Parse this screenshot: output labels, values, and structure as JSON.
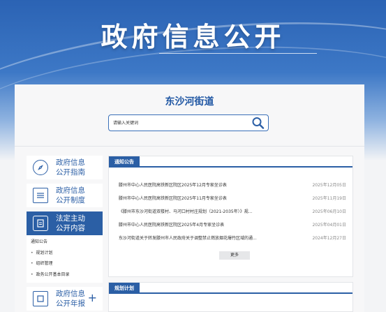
{
  "banner": {
    "title": "政府信息公开"
  },
  "district": {
    "name": "东沙河街道"
  },
  "search": {
    "placeholder": "请输入关键词"
  },
  "sidebar": {
    "items": [
      {
        "line1": "政府信息",
        "line2": "公开指南",
        "icon": "compass-icon"
      },
      {
        "line1": "政府信息",
        "line2": "公开制度",
        "icon": "document-list-icon"
      },
      {
        "line1": "法定主动",
        "line2": "公开内容",
        "icon": "clipboard-icon"
      },
      {
        "line1": "政府信息",
        "line2": "公开年报",
        "icon": "plus-icon"
      }
    ],
    "sub_items": [
      "通知公告",
      "规划计划",
      "组织管理",
      "政务公开基本目录"
    ]
  },
  "notice": {
    "heading": "通知公告",
    "items": [
      {
        "title": "滕州市中心人民医院高铁新区院区2025年12月专家坐诊表",
        "date": "2025年12月05日"
      },
      {
        "title": "滕州市中心人民医院高铁新区院区2025年11月专家坐诊表",
        "date": "2025年11月19日"
      },
      {
        "title": "《滕州市东沙河街道双楼村、马河口村村庄规划（2021-2035年）》规...",
        "date": "2025年06月10日"
      },
      {
        "title": "滕州市中心人民医院高铁新区院区2025年4月专家坐诊表",
        "date": "2025年04月01日"
      },
      {
        "title": "东沙河街道关于转发滕州市人民政府关于调整禁止燃放烟花爆竹区域的通...",
        "date": "2024年12月27日"
      }
    ],
    "more_label": "更多"
  },
  "planning": {
    "heading": "规划计划"
  },
  "colors": {
    "primary": "#2b5fa5",
    "banner_top": "#2b63b4"
  }
}
